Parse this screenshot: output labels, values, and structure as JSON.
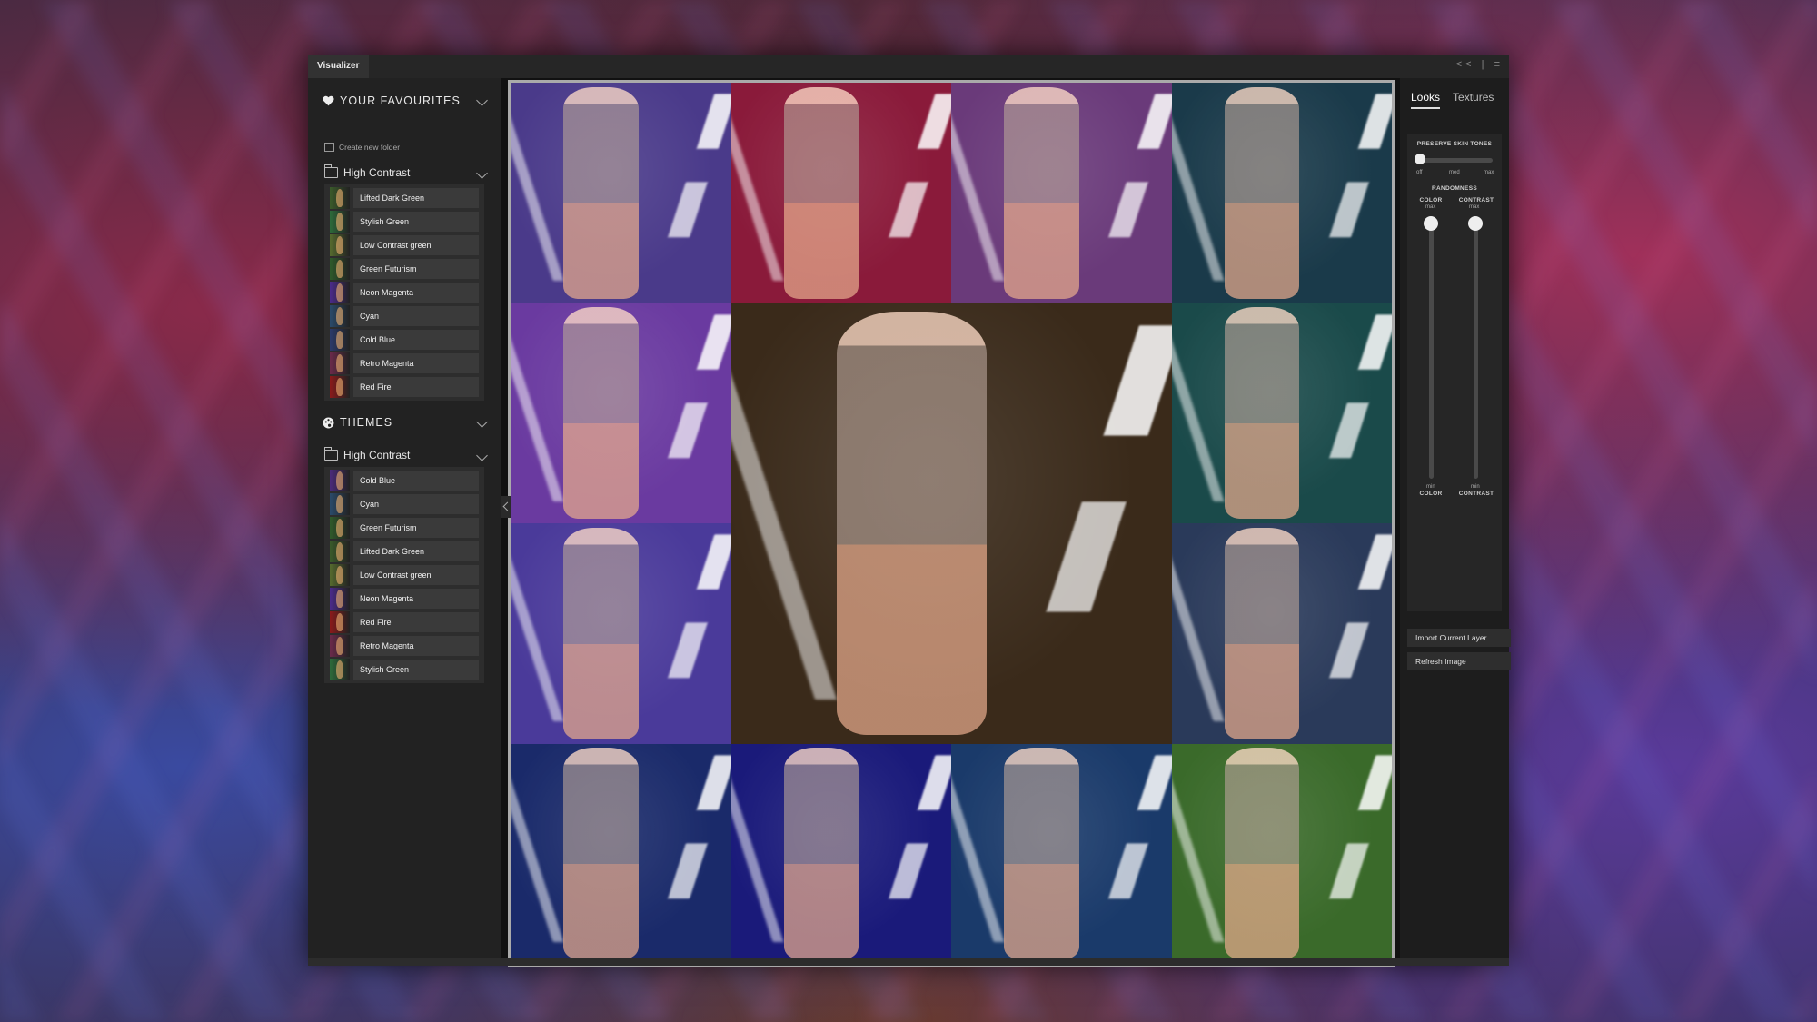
{
  "window": {
    "title": "Visualizer",
    "controls": "<< | ≡"
  },
  "left_panel": {
    "favourites": {
      "title": "YOUR FAVOURITES",
      "create_folder": "Create new folder",
      "folder": "High Contrast",
      "items": [
        {
          "label": "Lifted Dark Green",
          "color": "#3a5a2a"
        },
        {
          "label": "Stylish Green",
          "color": "#2d6a3a"
        },
        {
          "label": "Low Contrast green",
          "color": "#556a2e"
        },
        {
          "label": "Green Futurism",
          "color": "#2f5a2a"
        },
        {
          "label": "Neon Magenta",
          "color": "#4a2a8a"
        },
        {
          "label": "Cyan",
          "color": "#2a4a6a"
        },
        {
          "label": "Cold Blue",
          "color": "#2a3a6a"
        },
        {
          "label": "Retro Magenta",
          "color": "#6a2a4a"
        },
        {
          "label": "Red Fire",
          "color": "#8a1a1a"
        }
      ]
    },
    "themes": {
      "title": "THEMES",
      "folder": "High Contrast",
      "items": [
        {
          "label": "Cold Blue",
          "color": "#4a2a7a"
        },
        {
          "label": "Cyan",
          "color": "#2a4a6a"
        },
        {
          "label": "Green Futurism",
          "color": "#2f5a2a"
        },
        {
          "label": "Lifted Dark Green",
          "color": "#3a5a2a"
        },
        {
          "label": "Low Contrast green",
          "color": "#556a2e"
        },
        {
          "label": "Neon Magenta",
          "color": "#4a2a8a"
        },
        {
          "label": "Red Fire",
          "color": "#8a1a1a"
        },
        {
          "label": "Retro Magenta",
          "color": "#6a2a4a"
        },
        {
          "label": "Stylish Green",
          "color": "#2d6a3a"
        }
      ]
    }
  },
  "grid": {
    "cells": [
      {
        "tint": "#4a3a8a"
      },
      {
        "tint": "#8a1a3a"
      },
      {
        "tint": "#6a3a7a"
      },
      {
        "tint": "#1a3a4a"
      },
      {
        "tint": "#6a3aa0"
      },
      {
        "tint": "#3a2a1a"
      },
      {
        "tint": "#1a4a4a"
      },
      {
        "tint": "#4a3a9a"
      },
      {
        "tint": "#2a3a5a"
      },
      {
        "tint": "#1a2a6a"
      },
      {
        "tint": "#1a1a7a"
      },
      {
        "tint": "#1a3a6a"
      },
      {
        "tint": "#3a6a2a"
      }
    ]
  },
  "right_panel": {
    "tabs": [
      "Looks",
      "Textures"
    ],
    "preserve_skin_tones": {
      "label": "PRESERVE SKIN TONES",
      "marks": [
        "off",
        "med",
        "max"
      ],
      "value": 0.0
    },
    "randomness": {
      "label": "RANDOMNESS",
      "color": {
        "top_label": "COLOR",
        "max_label": "max",
        "min_label": "min",
        "bottom_label": "COLOR",
        "value": 1.0
      },
      "contrast": {
        "top_label": "CONTRAST",
        "max_label": "max",
        "min_label": "min",
        "bottom_label": "CONTRAST",
        "value": 1.0
      }
    },
    "buttons": {
      "import": "Import Current Layer",
      "refresh": "Refresh Image"
    }
  }
}
